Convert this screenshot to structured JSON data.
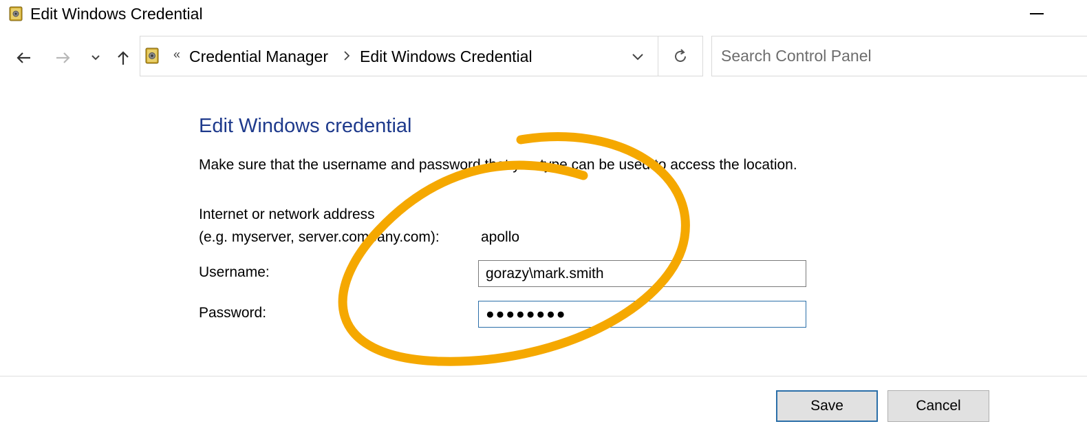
{
  "window": {
    "title": "Edit Windows Credential"
  },
  "nav": {
    "back_icon": "back-arrow-icon",
    "forward_icon": "forward-arrow-icon",
    "recent_icon": "chevron-down-icon",
    "up_icon": "up-arrow-icon"
  },
  "address_bar": {
    "overflow": "«",
    "breadcrumbs": [
      "Credential Manager",
      "Edit Windows Credential"
    ]
  },
  "search": {
    "placeholder": "Search Control Panel"
  },
  "content": {
    "heading": "Edit Windows credential",
    "instructions": "Make sure that the username and password that you type can be used to access the location.",
    "address_label_line1": "Internet or network address",
    "address_label_line2": "(e.g. myserver, server.company.com):",
    "address_value": "apollo",
    "username_label": "Username:",
    "username_value": "gorazy\\mark.smith",
    "password_label": "Password:",
    "password_value": "●●●●●●●●"
  },
  "buttons": {
    "save": "Save",
    "cancel": "Cancel"
  },
  "colors": {
    "heading": "#1e3a8c",
    "annotation": "#f5a800",
    "focus_border": "#2a6ea8"
  }
}
